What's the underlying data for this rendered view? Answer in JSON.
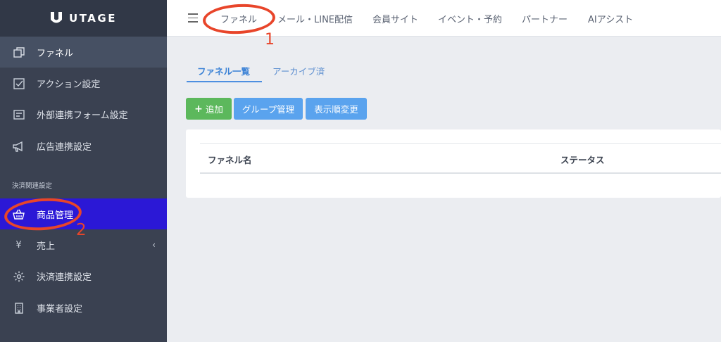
{
  "brand": {
    "name": "UTAGE"
  },
  "sidebar": {
    "items": [
      {
        "label": "ファネル",
        "icon": "copy-icon"
      },
      {
        "label": "アクション設定",
        "icon": "checkbox-icon"
      },
      {
        "label": "外部連携フォーム設定",
        "icon": "form-icon"
      },
      {
        "label": "広告連携設定",
        "icon": "megaphone-icon"
      }
    ],
    "section_label": "決済関連設定",
    "payment_items": [
      {
        "label": "商品管理",
        "icon": "basket-icon"
      },
      {
        "label": "売上",
        "icon": "yen-icon"
      },
      {
        "label": "決済連携設定",
        "icon": "gear-icon"
      },
      {
        "label": "事業者設定",
        "icon": "building-icon"
      }
    ]
  },
  "topnav": {
    "items": [
      "ファネル",
      "メール・LINE配信",
      "会員サイト",
      "イベント・予約",
      "パートナー",
      "AIアシスト"
    ]
  },
  "tabs": [
    "ファネル一覧",
    "アーカイブ済"
  ],
  "buttons": {
    "add": "追加",
    "add_prefix": "+",
    "group": "グループ管理",
    "order": "表示順変更"
  },
  "table": {
    "columns": [
      "ファネル名",
      "ステータス"
    ]
  },
  "annotations": {
    "one": "1",
    "two": "2"
  },
  "colors": {
    "sidebar": "#3a4151",
    "active_item": "#2b18d6",
    "annotation": "#e8452a",
    "accent": "#4d8fe0",
    "add_button": "#5cb85c"
  }
}
